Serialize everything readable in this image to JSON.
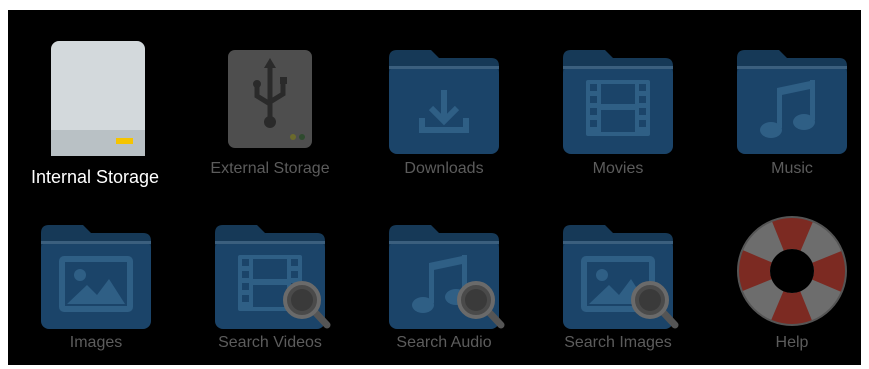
{
  "storage": {
    "items": [
      {
        "label": "Internal Storage",
        "icon": "internal-storage-icon",
        "selected": true
      },
      {
        "label": "External Storage",
        "icon": "usb-drive-icon",
        "selected": false
      },
      {
        "label": "Downloads",
        "icon": "download-folder-icon",
        "selected": false
      },
      {
        "label": "Movies",
        "icon": "film-folder-icon",
        "selected": false
      },
      {
        "label": "Music",
        "icon": "music-folder-icon",
        "selected": false
      },
      {
        "label": "Images",
        "icon": "image-folder-icon",
        "selected": false
      },
      {
        "label": "Search Videos",
        "icon": "search-videos-icon",
        "selected": false
      },
      {
        "label": "Search Audio",
        "icon": "search-audio-icon",
        "selected": false
      },
      {
        "label": "Search Images",
        "icon": "search-images-icon",
        "selected": false
      },
      {
        "label": "Help",
        "icon": "lifebuoy-icon",
        "selected": false
      }
    ]
  },
  "colors": {
    "background": "#000000",
    "folder": "#1b4469",
    "folder_tab": "#163957",
    "folder_glyph": "#2f5f85",
    "label_dim": "#5c5c5c",
    "label_selected": "#ffffff",
    "drive_light": "#d3d9dc",
    "drive_indicator": "#f5c400",
    "usb_drive": "#4e4e4e",
    "lifebuoy_red": "#7c2a22",
    "lifebuoy_grey": "#6d6d6d"
  }
}
